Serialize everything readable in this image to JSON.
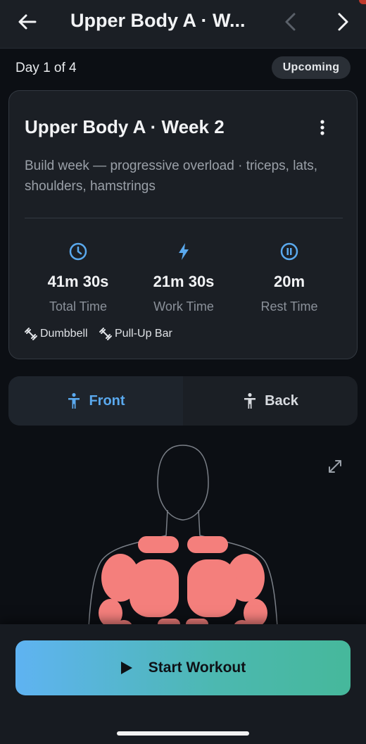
{
  "header": {
    "title": "Upper Body A · W...",
    "back_icon": "arrow-left-icon",
    "prev_icon": "chevron-left-icon",
    "next_icon": "chevron-right-icon"
  },
  "progress": {
    "day_label": "Day 1 of 4",
    "status_badge": "Upcoming"
  },
  "workout_card": {
    "title": "Upper Body A · Week 2",
    "description": "Build week — progressive overload · triceps, lats, shoulders, hamstrings",
    "stats": [
      {
        "icon": "clock-icon",
        "value": "41m 30s",
        "label": "Total Time"
      },
      {
        "icon": "bolt-icon",
        "value": "21m 30s",
        "label": "Work Time"
      },
      {
        "icon": "pause-icon",
        "value": "20m",
        "label": "Rest Time"
      }
    ],
    "equipment": [
      "Dumbbell",
      "Pull-Up Bar"
    ]
  },
  "view_toggle": {
    "front_label": "Front",
    "back_label": "Back",
    "selected": "Front"
  },
  "actions": {
    "start_label": "Start Workout"
  },
  "colors": {
    "accent_blue": "#5aa9ee",
    "muscle_highlight": "#f47f7c",
    "gradient_start": "#5fb3f2",
    "gradient_end": "#46b89b",
    "card_bg": "#1b1f25"
  }
}
